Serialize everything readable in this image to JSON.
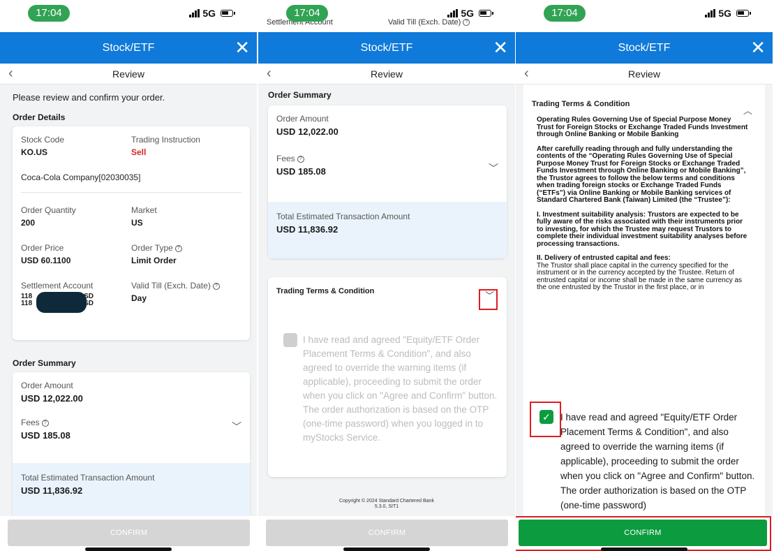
{
  "status": {
    "time": "17:04",
    "network": "5G"
  },
  "header": {
    "title": "Stock/ETF",
    "close": "✕"
  },
  "subheader": {
    "title": "Review",
    "back": "‹"
  },
  "panel1": {
    "intro": "Please review and confirm your order.",
    "order_details_title": "Order Details",
    "stock_code_label": "Stock Code",
    "stock_code": "KO.US",
    "trading_instruction_label": "Trading Instruction",
    "trading_instruction": "Sell",
    "company": "Coca-Cola Company[02030035]",
    "order_quantity_label": "Order Quantity",
    "order_quantity": "200",
    "market_label": "Market",
    "market": "US",
    "order_price_label": "Order Price",
    "order_price": "USD 60.1100",
    "order_type_label": "Order Type",
    "order_type": "Limit Order",
    "settlement_account_label": "Settlement Account",
    "account_line1_a": "118",
    "account_line1_b": "SD",
    "account_line2_a": "118",
    "account_line2_b": "SD",
    "valid_till_label": "Valid Till (Exch. Date)",
    "valid_till": "Day",
    "order_summary_title": "Order Summary",
    "order_amount_label": "Order Amount",
    "order_amount": "USD 12,022.00",
    "fees_label": "Fees",
    "fees": "USD 185.08",
    "total_label": "Total Estimated Transaction Amount",
    "total": "USD 11,836.92"
  },
  "panel2": {
    "status_overlay_left": "Settlement Account",
    "status_overlay_right": "Valid Till (Exch. Date)",
    "order_summary_title": "Order Summary",
    "order_amount_label": "Order Amount",
    "order_amount": "USD 12,022.00",
    "fees_label": "Fees",
    "fees": "USD 185.08",
    "total_label": "Total Estimated Transaction Amount",
    "total": "USD 11,836.92",
    "terms_title": "Trading Terms & Condition",
    "agree_text": "I have read and agreed \"Equity/ETF Order Placement Terms & Condition\", and also agreed to override the warning items (if applicable), proceeding to submit the order when you click on \"Agree and Confirm\" button. The order authorization is based on the OTP (one-time password) when you logged in to myStocks Service.",
    "copyright": "Copyright © 2024 Standard Chartered Bank",
    "version": "5.3.0, SIT1"
  },
  "panel3": {
    "terms_title": "Trading Terms & Condition",
    "heading1": "Operating Rules Governing Use of Special Purpose Money Trust for Foreign Stocks or Exchange Traded Funds Investment through Online Banking or Mobile Banking",
    "para1": "After carefully reading through and fully understanding the contents of the “Operating Rules Governing Use of Special Purpose Money Trust for Foreign Stocks or Exchange Traded Funds Investment through Online Banking or Mobile Banking”, the Trustor agrees to follow the below terms and conditions when trading foreign stocks or Exchange Traded Funds (“ETFs”) via Online Banking or Mobile Banking services of Standard Chartered Bank (Taiwan) Limited (the “Trustee”):",
    "para2": "I. Investment suitability analysis: Trustors are expected to be fully aware of the risks associated with their instruments prior to investing, for which the Trustee may request Trustors to complete their individual investment suitability analyses before processing transactions.",
    "heading2": "II. Delivery of entrusted capital and fees:",
    "para3": "The Trustor shall place capital in the currency specified for the instrument or in the currency accepted by the Trustee. Return of entrusted capital or income shall be made in the same currency as the one entrusted by the Trustor in the first place, or in",
    "agree_text": "I have read and agreed \"Equity/ETF Order Placement Terms & Condition\", and also agreed to override the warning items (if applicable), proceeding to submit the order when you click on \"Agree and Confirm\" button. The order authorization is based on the OTP (one-time password)"
  },
  "confirm_label": "CONFIRM",
  "colors": {
    "header": "#0f7ad9",
    "accent_green": "#0c9c3f",
    "sell_red": "#d8232a",
    "highlight_red": "#e01b22"
  }
}
